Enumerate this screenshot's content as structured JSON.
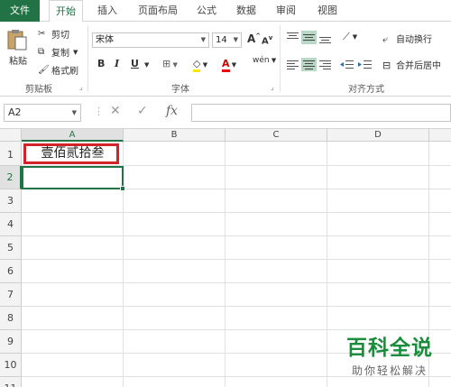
{
  "ribbon_tabs": [
    "文件",
    "开始",
    "插入",
    "页面布局",
    "公式",
    "数据",
    "审阅",
    "视图"
  ],
  "clipboard": {
    "paste_label": "粘贴",
    "cut_label": "剪切",
    "copy_label": "复制",
    "format_painter_label": "格式刷",
    "group_label": "剪贴板"
  },
  "font": {
    "font_name": "宋体",
    "font_size": "14",
    "bold": "B",
    "italic": "I",
    "underline": "U",
    "grow": "A",
    "shrink": "A",
    "font_color_letter": "A",
    "phonetic": "wén",
    "group_label": "字体"
  },
  "alignment": {
    "wrap_label": "自动换行",
    "merge_label": "合并后居中",
    "group_label": "对齐方式"
  },
  "formula_bar": {
    "name_box": "A2",
    "formula": ""
  },
  "grid": {
    "columns": [
      "A",
      "B",
      "C",
      "D"
    ],
    "rows": [
      "1",
      "2",
      "3",
      "4",
      "5",
      "6",
      "7",
      "8",
      "9",
      "10",
      "11"
    ],
    "cell_a1": "壹佰贰拾叁",
    "selected_cell": "A2"
  },
  "watermark": {
    "title": "百科全说",
    "subtitle": "助你轻松解决"
  },
  "colors": {
    "accent": "#217346",
    "highlight_border": "#d2232a",
    "watermark_green": "#1a8c3c"
  }
}
